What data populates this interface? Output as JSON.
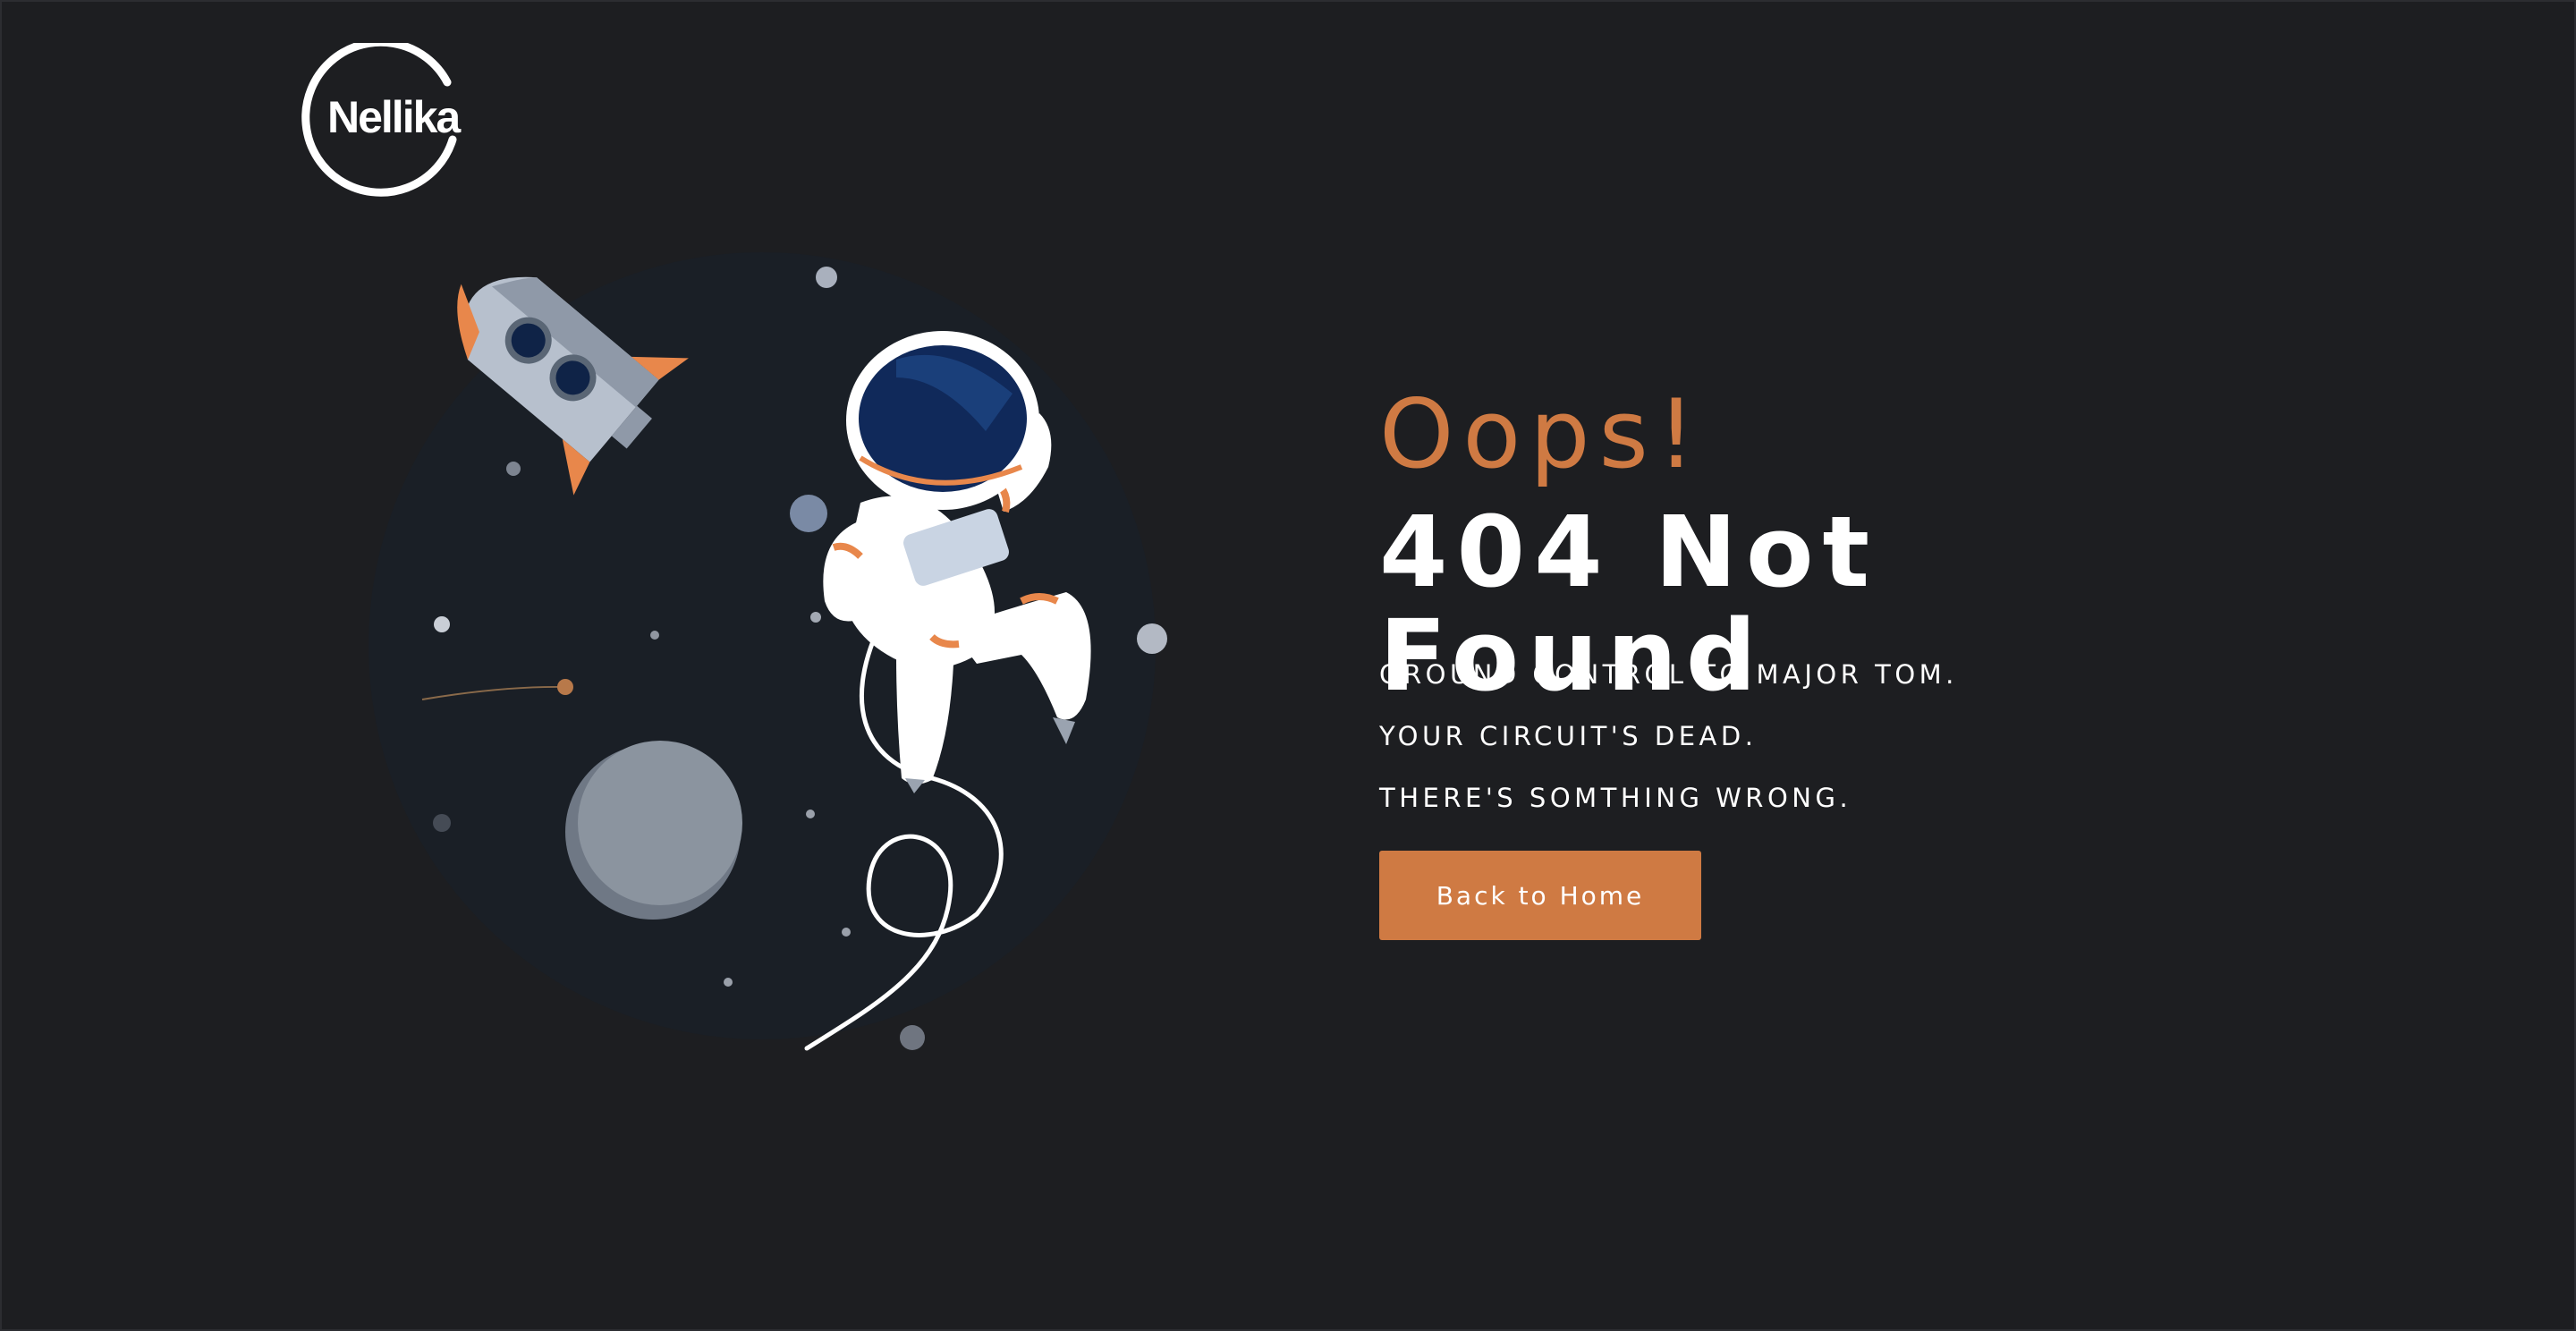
{
  "brand": {
    "name": "Nellika",
    "accent_color": "#cf7a43",
    "background_color": "#1d1e21"
  },
  "error": {
    "exclamation": "Oops!",
    "title": "404 Not Found",
    "messages": [
      "GROUND CONTROL TO MAJOR TOM.",
      "YOUR CIRCUIT'S DEAD.",
      "THERE'S SOMTHING WRONG."
    ]
  },
  "actions": {
    "home_button_label": "Back to Home"
  },
  "illustration": {
    "elements": [
      "rocket",
      "astronaut",
      "moon",
      "stars",
      "shooting-star",
      "tether"
    ]
  }
}
